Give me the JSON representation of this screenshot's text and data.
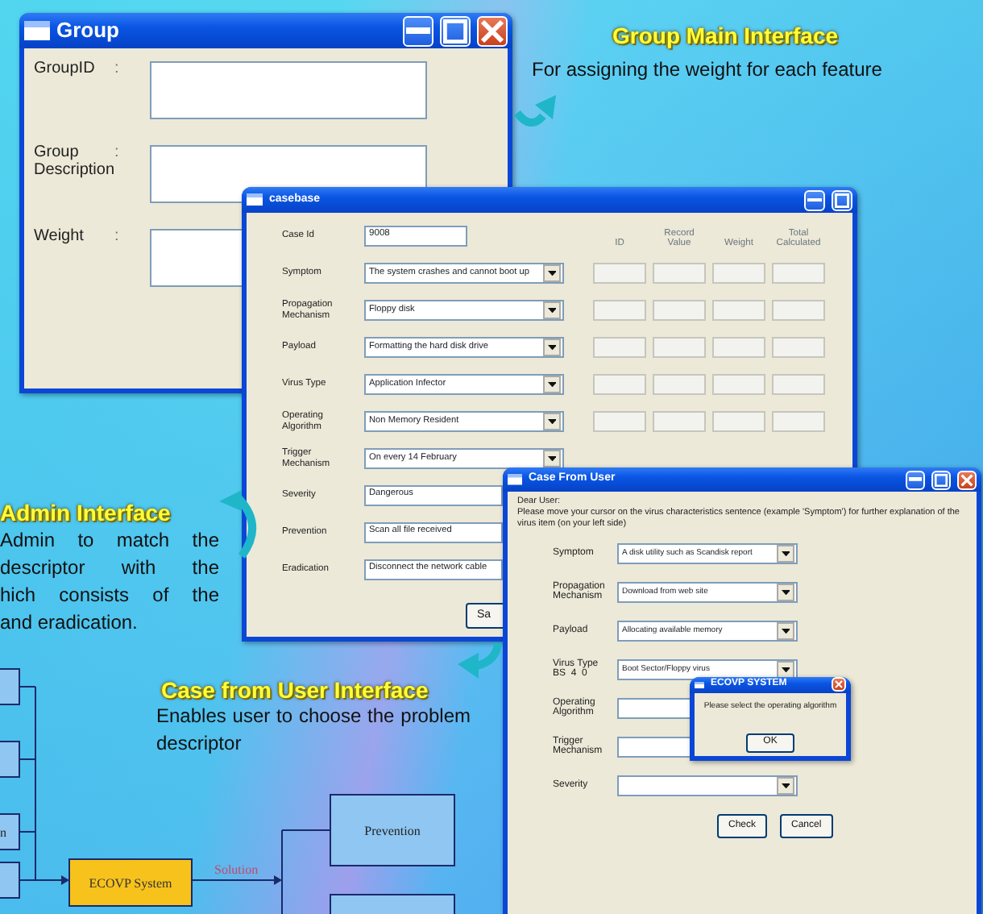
{
  "group_window": {
    "title": "Group",
    "fields": [
      {
        "label": "GroupID",
        "colon": ":"
      },
      {
        "label": "Group Description",
        "colon": ":"
      },
      {
        "label": "Weight",
        "colon": ":"
      }
    ]
  },
  "group_caption": {
    "heading": "Group Main Interface",
    "text": "For assigning the weight for each feature"
  },
  "casebase_window": {
    "title": "casebase",
    "case_id": {
      "label": "Case Id",
      "value": "9008"
    },
    "columns": [
      "ID",
      "Record Value",
      "Weight",
      "Total Calculated"
    ],
    "rows": [
      {
        "label": "Symptom",
        "kind": "scored",
        "value": "The system crashes and cannot boot up"
      },
      {
        "label": "Propagation Mechanism",
        "kind": "scored",
        "value": "Floppy disk"
      },
      {
        "label": "Payload",
        "kind": "scored",
        "value": "Formatting the hard disk drive"
      },
      {
        "label": "Virus Type",
        "kind": "scored",
        "value": "Application Infector"
      },
      {
        "label": "Operating Algorithm",
        "kind": "scored",
        "value": "Non Memory Resident"
      },
      {
        "label": "Trigger Mechanism",
        "kind": "combo",
        "value": "On every 14 February"
      },
      {
        "label": "Severity",
        "kind": "text",
        "value": "Dangerous"
      },
      {
        "label": "Prevention",
        "kind": "text",
        "value": "Scan all file received"
      },
      {
        "label": "Eradication",
        "kind": "text",
        "value": "Disconnect the network cable"
      }
    ],
    "button": "Sa"
  },
  "admin_caption": {
    "heading": "Admin Interface",
    "lines": [
      "Admin to match the",
      "descriptor with the",
      "hich consists of the",
      "and eradication."
    ]
  },
  "user_caption": {
    "heading": "Case from User Interface",
    "text": "Enables user to choose the problem descriptor"
  },
  "user_window": {
    "title": "Case From User",
    "greeting": "Dear User:",
    "instructions": "Please move your cursor on the virus characteristics sentence (example 'Symptom') for further explanation of the virus item (on your left side)",
    "rows": [
      {
        "label": "Symptom",
        "kind": "combo",
        "value": "A disk utility such as Scandisk report"
      },
      {
        "label": "Propagation Mechanism",
        "kind": "combo",
        "value": "Download from web site"
      },
      {
        "label": "Payload",
        "kind": "combo",
        "value": "Allocating available memory"
      },
      {
        "label": "Virus Type",
        "kind": "combo",
        "value": "Boot Sector/Floppy virus",
        "note": "BS  4  0"
      },
      {
        "label": "Operating Algorithm",
        "kind": "text"
      },
      {
        "label": "Trigger Mechanism",
        "kind": "text"
      },
      {
        "label": "Severity",
        "kind": "combo"
      }
    ],
    "buttons": [
      "Check",
      "Cancel"
    ]
  },
  "dialog": {
    "title": "ECOVP SYSTEM",
    "message": "Please select the operating algorithm",
    "button": "OK"
  },
  "diagram": {
    "left_boxes": [
      {
        "kind": "box"
      },
      {
        "kind": "box"
      },
      {
        "kind": "box",
        "label": "n"
      },
      {
        "kind": "box"
      }
    ],
    "system": "ECOVP System",
    "edge_label": "Solution",
    "right_boxes": [
      {
        "kind": "box",
        "label": "Prevention"
      },
      {
        "kind": "box"
      }
    ]
  }
}
